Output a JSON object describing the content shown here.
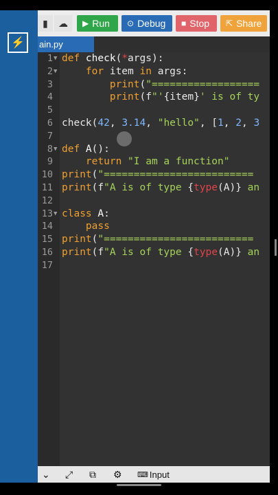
{
  "toolbar": {
    "run": "Run",
    "debug": "Debug",
    "stop": "Stop",
    "share": "Share",
    "colors": {
      "run": "#2fa64a",
      "debug": "#2a6bb5",
      "stop": "#e06469",
      "share": "#f0a33a"
    }
  },
  "tab": {
    "filename": "ain.py"
  },
  "editor": {
    "lines": [
      {
        "n": "1",
        "fold": "▼",
        "parts": [
          [
            "kw",
            "def "
          ],
          [
            "fn",
            "check"
          ],
          [
            "pl",
            "("
          ],
          [
            "builtin",
            "*"
          ],
          [
            "pl",
            "args):"
          ]
        ]
      },
      {
        "n": "2",
        "fold": "▼",
        "parts": [
          [
            "pl",
            "    "
          ],
          [
            "kw",
            "for "
          ],
          [
            "pl",
            "item "
          ],
          [
            "kw",
            "in "
          ],
          [
            "pl",
            "args:"
          ]
        ]
      },
      {
        "n": "3",
        "fold": "",
        "parts": [
          [
            "pl",
            "        "
          ],
          [
            "kw",
            "print"
          ],
          [
            "pl",
            "("
          ],
          [
            "str",
            "\"=================="
          ]
        ]
      },
      {
        "n": "4",
        "fold": "",
        "parts": [
          [
            "pl",
            "        "
          ],
          [
            "kw",
            "print"
          ],
          [
            "pl",
            "(f"
          ],
          [
            "str",
            "\"'"
          ],
          [
            "pl",
            "{item}"
          ],
          [
            "str",
            "' is of ty"
          ]
        ]
      },
      {
        "n": "5",
        "fold": "",
        "parts": []
      },
      {
        "n": "6",
        "fold": "",
        "parts": [
          [
            "pl",
            "check("
          ],
          [
            "num",
            "42"
          ],
          [
            "pl",
            ", "
          ],
          [
            "num",
            "3.14"
          ],
          [
            "pl",
            ", "
          ],
          [
            "str",
            "\"hello\""
          ],
          [
            "pl",
            ", ["
          ],
          [
            "num",
            "1"
          ],
          [
            "pl",
            ", "
          ],
          [
            "num",
            "2"
          ],
          [
            "pl",
            ", "
          ],
          [
            "num",
            "3"
          ]
        ]
      },
      {
        "n": "7",
        "fold": "",
        "parts": []
      },
      {
        "n": "8",
        "fold": "▼",
        "parts": [
          [
            "kw",
            "def "
          ],
          [
            "fn",
            "A"
          ],
          [
            "pl",
            "():"
          ]
        ]
      },
      {
        "n": "9",
        "fold": "",
        "parts": [
          [
            "pl",
            "    "
          ],
          [
            "kw",
            "return "
          ],
          [
            "str",
            "\"I am a function\""
          ]
        ]
      },
      {
        "n": "10",
        "fold": "",
        "parts": [
          [
            "kw",
            "print"
          ],
          [
            "pl",
            "("
          ],
          [
            "str",
            "\"========================="
          ]
        ]
      },
      {
        "n": "11",
        "fold": "",
        "parts": [
          [
            "kw",
            "print"
          ],
          [
            "pl",
            "(f"
          ],
          [
            "str",
            "\"A is of type "
          ],
          [
            "pl",
            "{"
          ],
          [
            "builtin",
            "type"
          ],
          [
            "pl",
            "(A)}"
          ],
          [
            "str",
            " an"
          ]
        ]
      },
      {
        "n": "12",
        "fold": "",
        "parts": []
      },
      {
        "n": "13",
        "fold": "▼",
        "parts": [
          [
            "kw",
            "class "
          ],
          [
            "fn",
            "A"
          ],
          [
            "pl",
            ":"
          ]
        ]
      },
      {
        "n": "14",
        "fold": "",
        "parts": [
          [
            "pl",
            "    "
          ],
          [
            "kw",
            "pass"
          ]
        ]
      },
      {
        "n": "15",
        "fold": "",
        "parts": [
          [
            "kw",
            "print"
          ],
          [
            "pl",
            "("
          ],
          [
            "str",
            "\"========================="
          ]
        ]
      },
      {
        "n": "16",
        "fold": "",
        "parts": [
          [
            "kw",
            "print"
          ],
          [
            "pl",
            "(f"
          ],
          [
            "str",
            "\"A is of type "
          ],
          [
            "pl",
            "{"
          ],
          [
            "builtin",
            "type"
          ],
          [
            "pl",
            "(A)}"
          ],
          [
            "str",
            " an"
          ]
        ]
      },
      {
        "n": "17",
        "fold": "",
        "parts": []
      }
    ]
  },
  "bottom": {
    "input_label": "Input"
  }
}
